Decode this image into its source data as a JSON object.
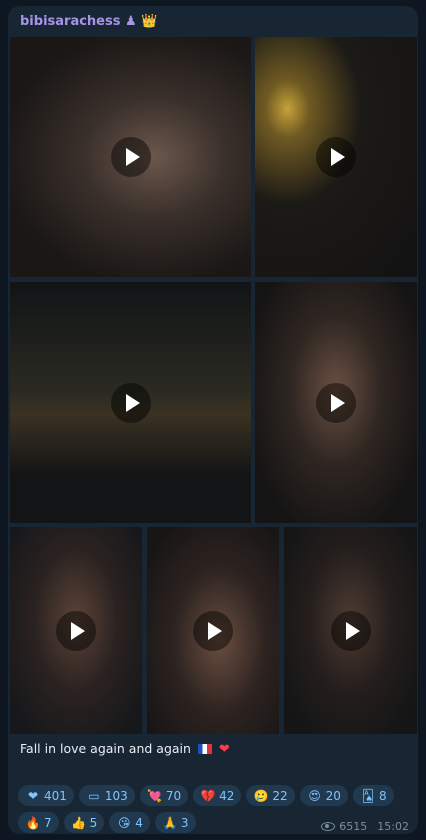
{
  "post": {
    "author": "bibisarachess",
    "author_suffix": "♟ 👑",
    "caption": "Fall in love again and again",
    "caption_emojis": [
      "flag-france",
      "red-heart"
    ],
    "views": "6515",
    "time": "15:02"
  },
  "media": [
    {
      "name": "video-couple-selfie",
      "kind": "video",
      "bg": "#2b2624"
    },
    {
      "name": "video-eiffel-selfie",
      "kind": "video",
      "bg": "#1d1b18"
    },
    {
      "name": "video-eiffel-river",
      "kind": "video",
      "bg": "#14181a"
    },
    {
      "name": "video-street-selfie",
      "kind": "video",
      "bg": "#1e1c1b"
    },
    {
      "name": "video-bridge-selfie",
      "kind": "video",
      "bg": "#1b1c20"
    },
    {
      "name": "video-upside-down",
      "kind": "video",
      "bg": "#201b19"
    },
    {
      "name": "video-night-selfie",
      "kind": "video",
      "bg": "#18191b"
    }
  ],
  "reactions": [
    [
      {
        "emoji": "❤",
        "icon": "red-heart",
        "count": "401"
      },
      {
        "emoji": "▭",
        "icon": "bar-emoji",
        "count": "103"
      },
      {
        "emoji": "💘",
        "icon": "heart-arrow",
        "count": "70"
      },
      {
        "emoji": "💔",
        "icon": "broken-heart",
        "count": "42"
      },
      {
        "emoji": "🥲",
        "icon": "smile-tear",
        "count": "22"
      },
      {
        "emoji": "😍",
        "icon": "heart-eyes",
        "count": "20"
      },
      {
        "emoji": "🂡",
        "icon": "cards",
        "count": "8"
      }
    ],
    [
      {
        "emoji": "🔥",
        "icon": "fire",
        "count": "7"
      },
      {
        "emoji": "👍",
        "icon": "thumbs-up",
        "count": "5"
      },
      {
        "emoji": "😘",
        "icon": "kiss",
        "count": "4"
      },
      {
        "emoji": "🙏",
        "icon": "praying-hands",
        "count": "3"
      }
    ]
  ],
  "colors": {
    "background": "#0e1621",
    "bubble": "#182533",
    "author": "#a695e7",
    "reaction_bg": "#21394e",
    "reaction_text": "#7fc3ff"
  }
}
